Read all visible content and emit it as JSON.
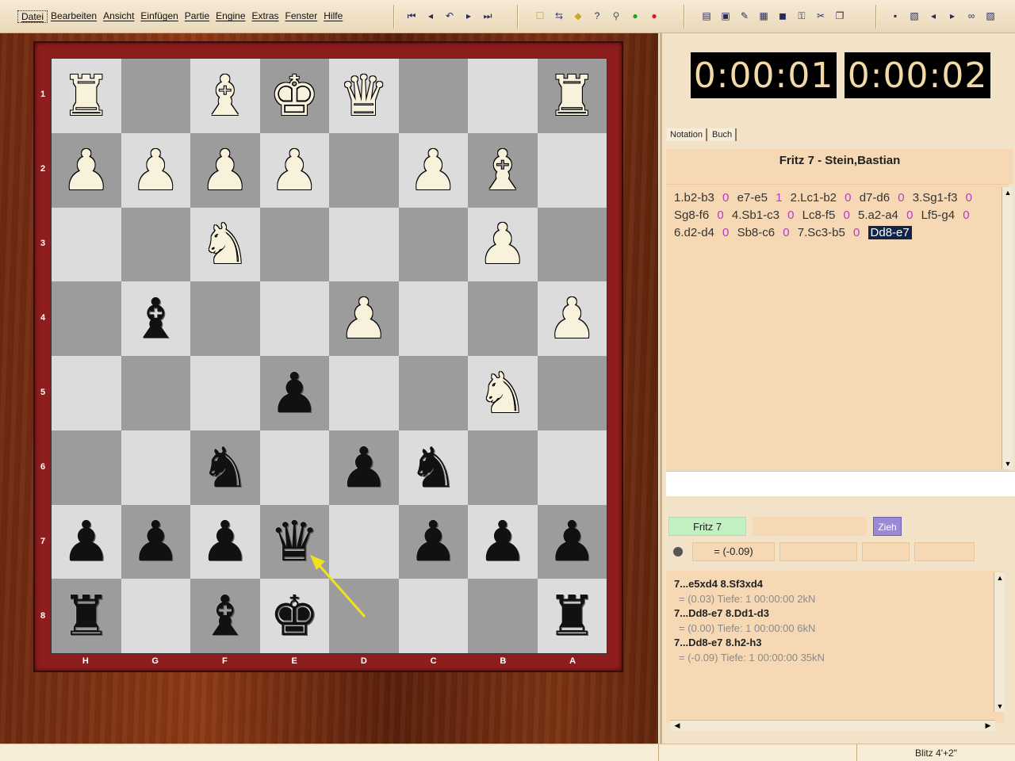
{
  "menu": [
    "Datei",
    "Bearbeiten",
    "Ansicht",
    "Einfügen",
    "Partie",
    "Engine",
    "Extras",
    "Fenster",
    "Hilfe"
  ],
  "toolbar": {
    "nav_icons": [
      "first-move-icon",
      "prev-move-icon",
      "takeback-icon",
      "next-move-icon",
      "last-move-icon"
    ],
    "nav_glyphs": [
      "⏮",
      "◂",
      "↶",
      "▸",
      "⏭"
    ],
    "game_icons": [
      "new-game-icon",
      "flip-board-icon",
      "engine-move-icon",
      "hint-icon",
      "analysis-icon",
      "accept-icon",
      "resign-icon"
    ],
    "game_glyphs": [
      "☐",
      "⇆",
      "◆",
      "?",
      "⚲",
      "●",
      "●"
    ],
    "game_colors": [
      "#c8a82a",
      "#3c3c8c",
      "#c8a82a",
      "#2a2a5a",
      "#555555",
      "#1aa61a",
      "#d81a1a"
    ],
    "tool_icons": [
      "print-icon",
      "camera-icon",
      "pen-icon",
      "grid-icon",
      "window-icon",
      "key-icon",
      "tools-icon",
      "window-list-icon"
    ],
    "tool_glyphs": [
      "▤",
      "▣",
      "✎",
      "▦",
      "◼",
      "⚿",
      "✂",
      "❐"
    ],
    "file_icons": [
      "save-icon",
      "copy-icon",
      "back-icon",
      "forward-icon",
      "binoculars-icon",
      "paste-icon"
    ],
    "file_glyphs": [
      "▪",
      "▧",
      "◂",
      "▸",
      "∞",
      "▨"
    ]
  },
  "board": {
    "rank_labels": [
      "1",
      "2",
      "3",
      "4",
      "5",
      "6",
      "7",
      "8"
    ],
    "file_labels": [
      "H",
      "G",
      "F",
      "E",
      "D",
      "C",
      "B",
      "A"
    ],
    "light_color": "#dcdcdc",
    "dark_color": "#9c9c9c",
    "rows": [
      [
        "wR",
        "",
        "wB",
        "wK",
        "wQ",
        "",
        "",
        "wR"
      ],
      [
        "wP",
        "wP",
        "wP",
        "wP",
        "",
        "wP",
        "wB",
        ""
      ],
      [
        "",
        "",
        "wN",
        "",
        "",
        "",
        "wP",
        ""
      ],
      [
        "",
        "bB",
        "",
        "",
        "wP",
        "",
        "",
        "wP"
      ],
      [
        "",
        "",
        "",
        "bP",
        "",
        "",
        "wN",
        ""
      ],
      [
        "",
        "",
        "bN",
        "",
        "bP",
        "bN",
        "",
        ""
      ],
      [
        "bP",
        "bP",
        "bP",
        "bQ",
        "",
        "bP",
        "bP",
        "bP"
      ],
      [
        "bR",
        "",
        "bB",
        "bK",
        "",
        "",
        "",
        "bR"
      ]
    ],
    "arrow_color": "#f2e21c"
  },
  "clocks": {
    "white": "0:00:01",
    "black": "0:00:02"
  },
  "tabs": [
    "Notation",
    "Buch"
  ],
  "game_title": "Fritz 7 - Stein,Bastian",
  "notation": [
    {
      "t": "1.b2-b3",
      "k": "move"
    },
    {
      "t": "0",
      "k": "zero"
    },
    {
      "t": "e7-e5",
      "k": "move"
    },
    {
      "t": "1",
      "k": "zero"
    },
    {
      "t": "2.Lc1-b2",
      "k": "move"
    },
    {
      "t": "0",
      "k": "zero"
    },
    {
      "t": "d7-d6",
      "k": "move"
    },
    {
      "t": "0",
      "k": "zero"
    },
    {
      "t": "3.Sg1-f3",
      "k": "move"
    },
    {
      "t": "0",
      "k": "zero"
    },
    {
      "t": "Sg8-f6",
      "k": "move"
    },
    {
      "t": "0",
      "k": "zero"
    },
    {
      "t": "4.Sb1-c3",
      "k": "move"
    },
    {
      "t": "0",
      "k": "zero"
    },
    {
      "t": "Lc8-f5",
      "k": "move"
    },
    {
      "t": "0",
      "k": "zero"
    },
    {
      "t": "5.a2-a4",
      "k": "move"
    },
    {
      "t": "0",
      "k": "zero"
    },
    {
      "t": "Lf5-g4",
      "k": "move"
    },
    {
      "t": "0",
      "k": "zero"
    },
    {
      "t": "6.d2-d4",
      "k": "move"
    },
    {
      "t": "0",
      "k": "zero"
    },
    {
      "t": "Sb8-c6",
      "k": "move"
    },
    {
      "t": "0",
      "k": "zero"
    },
    {
      "t": "7.Sc3-b5",
      "k": "move"
    },
    {
      "t": "0",
      "k": "zero"
    },
    {
      "t": "Dd8-e7",
      "k": "cur"
    }
  ],
  "engine": {
    "name": "Fritz 7",
    "move_button": "Zieh",
    "eval": "= (-0.09)",
    "analysis": [
      {
        "line": "7...e5xd4 8.Sf3xd4",
        "info": "= (0.03)  Tiefe: 1   00:00:00  2kN"
      },
      {
        "line": "7...Dd8-e7 8.Dd1-d3",
        "info": "= (0.00)  Tiefe: 1   00:00:00  6kN"
      },
      {
        "line": "7...Dd8-e7 8.h2-h3",
        "info": "= (-0.09)  Tiefe: 1   00:00:00  35kN"
      }
    ]
  },
  "status": {
    "mode": "Blitz 4'+2\""
  }
}
